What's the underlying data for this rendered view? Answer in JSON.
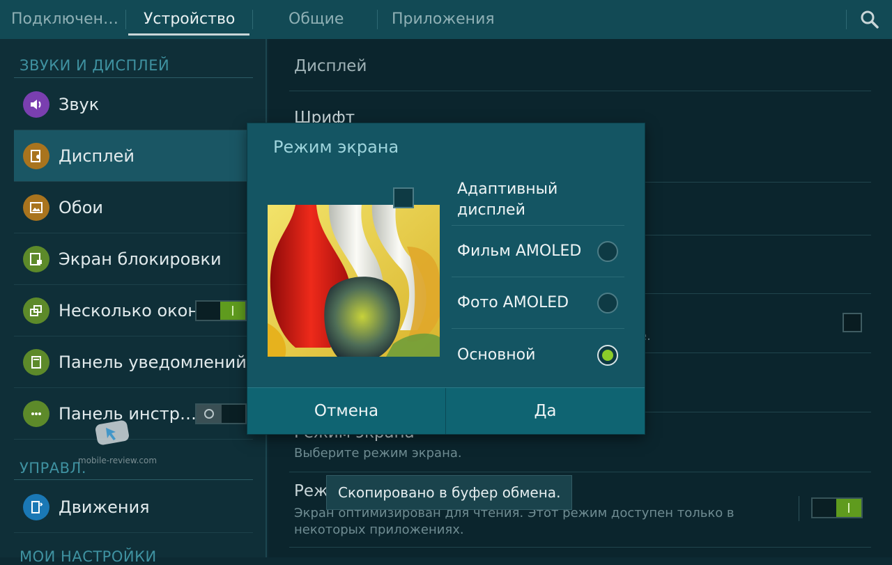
{
  "tabs": [
    {
      "label": "Подключен…"
    },
    {
      "label": "Устройство"
    },
    {
      "label": "Общие"
    },
    {
      "label": "Приложения"
    }
  ],
  "active_tab_index": 1,
  "search_icon": "search-icon",
  "sidebar": {
    "section_sound_display": "ЗВУКИ И ДИСПЛЕЙ",
    "items": [
      {
        "label": "Звук",
        "icon": "speaker-icon",
        "color": "#7a3fb0"
      },
      {
        "label": "Дисплей",
        "icon": "display-icon",
        "color": "#a9741e",
        "active": true
      },
      {
        "label": "Обои",
        "icon": "wallpaper-icon",
        "color": "#a9741e"
      },
      {
        "label": "Экран блокировки",
        "icon": "lock-screen-icon",
        "color": "#5d8a2a"
      },
      {
        "label": "Несколько окон",
        "icon": "multi-window-icon",
        "color": "#5d8a2a",
        "toggle": "on"
      },
      {
        "label": "Панель уведомлений",
        "icon": "notification-panel-icon",
        "color": "#5d8a2a"
      },
      {
        "label": "Панель инстр…",
        "icon": "toolbox-icon",
        "color": "#5d8a2a",
        "toggle": "off"
      }
    ],
    "section_control": "УПРАВЛ.",
    "control_items": [
      {
        "label": "Движения",
        "icon": "motions-icon",
        "color": "#1a78b5"
      }
    ],
    "section_my_settings": "МОИ НАСТРОЙКИ"
  },
  "content": {
    "display_header": "Дисплей",
    "font_title": "Шрифт",
    "partial_suffix": "е.",
    "screen_mode_title": "Режим экрана",
    "screen_mode_sub": "Выберите режим экрана.",
    "reading_mode_title": "Реж",
    "reading_mode_sub_1": "Экран оптимизирован для чтения. Этот режим доступен только в",
    "reading_mode_sub_2": "некоторых приложениях.",
    "reading_mode_toggle": "on"
  },
  "dialog": {
    "title": "Режим экрана",
    "options": [
      {
        "label_1": "Адаптивный",
        "label_2": "дисплей",
        "control": "checkbox",
        "checked": false
      },
      {
        "label": "Фильм AMOLED",
        "control": "radio",
        "checked": false
      },
      {
        "label": "Фото AMOLED",
        "control": "radio",
        "checked": false
      },
      {
        "label": "Основной",
        "control": "radio",
        "checked": true
      }
    ],
    "cancel_label": "Отмена",
    "ok_label": "Да"
  },
  "toast": "Скопировано в буфер обмена.",
  "watermark": "mobile-review.com",
  "colors": {
    "accent_green": "#8ccd2a",
    "toggle_on": "#5f9b1e",
    "dialog_bg": "#145563",
    "section_header": "#3f92a1"
  }
}
